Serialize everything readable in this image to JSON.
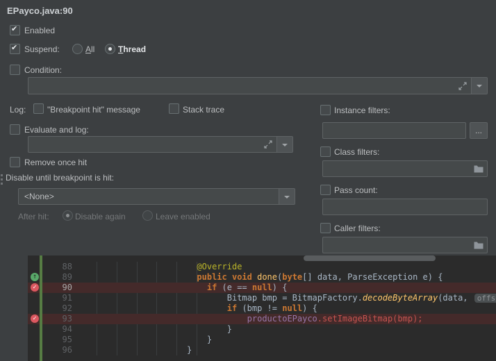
{
  "dialog": {
    "title": "EPayco.java:90",
    "enabled": {
      "label": "Enabled",
      "checked": true
    },
    "suspend": {
      "label": "Suspend:",
      "checked": true,
      "all": {
        "label": "All",
        "selected": false
      },
      "thread": {
        "label": "Thread",
        "selected": true
      }
    },
    "condition": {
      "label": "Condition:",
      "checked": false,
      "value": ""
    },
    "log": {
      "label": "Log:",
      "breakpoint_hit_message": {
        "label": "\"Breakpoint hit\" message",
        "checked": false
      },
      "stack_trace": {
        "label": "Stack trace",
        "checked": false
      }
    },
    "evaluate_and_log": {
      "label": "Evaluate and log:",
      "checked": false,
      "value": ""
    },
    "remove_once_hit": {
      "label": "Remove once hit",
      "checked": false
    },
    "disable_until": {
      "label": "Disable until breakpoint is hit:",
      "selected": "<None>"
    },
    "after_hit": {
      "label": "After hit:",
      "disable_again": {
        "label": "Disable again",
        "selected": true
      },
      "leave_enabled": {
        "label": "Leave enabled",
        "selected": false
      }
    },
    "instance_filters": {
      "label": "Instance filters:",
      "checked": false,
      "value": "",
      "browse": "..."
    },
    "class_filters": {
      "label": "Class filters:",
      "checked": false,
      "value": ""
    },
    "pass_count": {
      "label": "Pass count:",
      "checked": false,
      "value": ""
    },
    "caller_filters": {
      "label": "Caller filters:",
      "checked": false,
      "value": ""
    }
  },
  "editor": {
    "lines": [
      {
        "number": "88",
        "segments": [
          {
            "c": "def",
            "t": "                        "
          },
          {
            "c": "ann",
            "t": "@Override"
          }
        ]
      },
      {
        "number": "89",
        "icon": "override-icon",
        "segments": [
          {
            "c": "def",
            "t": "                        "
          },
          {
            "c": "key",
            "t": "public void "
          },
          {
            "c": "mdecl",
            "t": "done"
          },
          {
            "c": "def",
            "t": "("
          },
          {
            "c": "key",
            "t": "byte"
          },
          {
            "c": "def",
            "t": "[] data, ParseException e) {"
          }
        ]
      },
      {
        "number": "90",
        "icon": "breakpoint-icon",
        "highlight": true,
        "current": true,
        "segments": [
          {
            "c": "def",
            "t": "                          "
          },
          {
            "c": "key",
            "t": "if "
          },
          {
            "c": "def",
            "t": "(e == "
          },
          {
            "c": "key",
            "t": "null"
          },
          {
            "c": "def",
            "t": ") {"
          }
        ]
      },
      {
        "number": "91",
        "segments": [
          {
            "c": "def",
            "t": "                              Bitmap bmp = BitmapFactory."
          },
          {
            "c": "scall",
            "t": "decodeByteArray"
          },
          {
            "c": "def",
            "t": "(data, "
          },
          {
            "c": "hint",
            "t": "offset:"
          }
        ]
      },
      {
        "number": "92",
        "segments": [
          {
            "c": "def",
            "t": "                              "
          },
          {
            "c": "key",
            "t": "if "
          },
          {
            "c": "def",
            "t": "(bmp != "
          },
          {
            "c": "key",
            "t": "null"
          },
          {
            "c": "def",
            "t": ") {"
          }
        ]
      },
      {
        "number": "93",
        "icon": "breakpoint-icon",
        "highlight": true,
        "segments": [
          {
            "c": "def",
            "t": "                                  "
          },
          {
            "c": "field",
            "t": "productoEPayco"
          },
          {
            "c": "err",
            "t": ".setImageBitmap(bmp);"
          }
        ]
      },
      {
        "number": "94",
        "segments": [
          {
            "c": "def",
            "t": "                              }"
          }
        ]
      },
      {
        "number": "95",
        "segments": [
          {
            "c": "def",
            "t": "                          }"
          }
        ]
      },
      {
        "number": "96",
        "segments": [
          {
            "c": "def",
            "t": "                      }"
          }
        ]
      }
    ]
  }
}
